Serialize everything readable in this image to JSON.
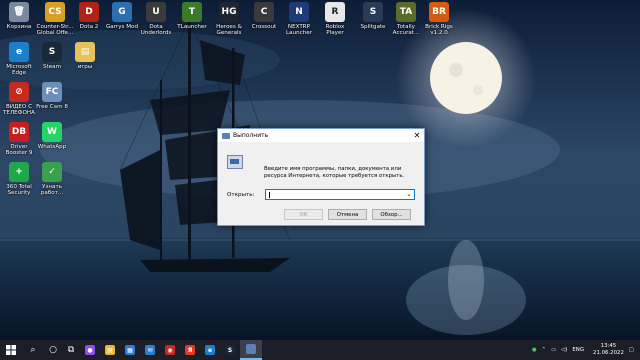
{
  "desktop": {
    "icons": [
      {
        "label": "Корзина",
        "color": "#7a8a9c",
        "glyph": "🗑"
      },
      {
        "label": "Counter-Str...\nGlobal Offe...",
        "color": "#d8a020",
        "glyph": "CS"
      },
      {
        "label": "Dota 2",
        "color": "#b02418",
        "glyph": "D"
      },
      {
        "label": "Garrys Mod",
        "color": "#2a6fb0",
        "glyph": "G"
      },
      {
        "label": "Dota\nUnderlords",
        "color": "#3b3b3b",
        "glyph": "U"
      },
      {
        "label": "TLauncher",
        "color": "#3c7a2a",
        "glyph": "T"
      },
      {
        "label": "Heroes &\nGenerals",
        "color": "#1c2530",
        "glyph": "HG"
      },
      {
        "label": "Crossout",
        "color": "#3a3a3a",
        "glyph": "C"
      },
      {
        "label": "NEXTRP\nLauncher",
        "color": "#1e3a78",
        "glyph": "N"
      },
      {
        "label": "Roblox\nPlayer",
        "color": "#e8e8e8",
        "glyph": "R"
      },
      {
        "label": "Splitgate",
        "color": "#2a3b55",
        "glyph": "S"
      },
      {
        "label": "Totally\nAccurat...",
        "color": "#5a6b2a",
        "glyph": "TA"
      },
      {
        "label": "Brick Rigs\nv1.2.0",
        "color": "#d65a12",
        "glyph": "BR"
      },
      {
        "label": "Microsoft\nEdge",
        "color": "#1d7fc9",
        "glyph": "e"
      },
      {
        "label": "Steam",
        "color": "#1b2838",
        "glyph": "S"
      },
      {
        "label": "игры",
        "color": "#e6c15c",
        "glyph": "▤"
      },
      {
        "label": "ВИДЕО С\nТЕЛЕФОНА",
        "color": "#c8281e",
        "glyph": "⊘"
      },
      {
        "label": "Free Cam 8",
        "color": "#6c8fb8",
        "glyph": "FC"
      },
      {
        "label": "Driver\nBooster 9",
        "color": "#c81e1e",
        "glyph": "DB"
      },
      {
        "label": "WhatsApp",
        "color": "#25d366",
        "glyph": "W"
      },
      {
        "label": "360 Total\nSecurity",
        "color": "#1ea84a",
        "glyph": "+"
      },
      {
        "label": "Узнать\nработ...",
        "color": "#3aa04c",
        "glyph": "✓"
      }
    ]
  },
  "run_dialog": {
    "title": "Выполнить",
    "close_glyph": "✕",
    "description": "Введите имя программы, папки, документа или ресурса Интернета, которые требуется открыть.",
    "open_label": "Открыть:",
    "input_value": "",
    "dropdown_glyph": "⌄",
    "ok_label": "ОК",
    "cancel_label": "Отмена",
    "browse_label": "Обзор..."
  },
  "taskbar": {
    "apps": [
      {
        "name": "search-icon",
        "glyph": "⌕",
        "color": ""
      },
      {
        "name": "cortana-icon",
        "glyph": "○",
        "color": ""
      },
      {
        "name": "task-view-icon",
        "glyph": "⧉",
        "color": ""
      },
      {
        "name": "alice-icon",
        "glyph": "●",
        "color": "#8a4dff"
      },
      {
        "name": "file-explorer-icon",
        "glyph": "▤",
        "color": "#e8b932"
      },
      {
        "name": "store-icon",
        "glyph": "▦",
        "color": "#2b7cd3"
      },
      {
        "name": "mail-icon",
        "glyph": "✉",
        "color": "#2b7cd3"
      },
      {
        "name": "recorder-icon",
        "glyph": "◉",
        "color": "#c8281e"
      },
      {
        "name": "yandex-browser-icon",
        "glyph": "Я",
        "color": "#e03c28"
      },
      {
        "name": "edge-icon",
        "glyph": "e",
        "color": "#1d7fc9"
      },
      {
        "name": "steam-icon",
        "glyph": "S",
        "color": "#1b2838"
      }
    ],
    "tray": {
      "language": "ENG",
      "time": "13:45",
      "date": "21.06.2022"
    }
  }
}
